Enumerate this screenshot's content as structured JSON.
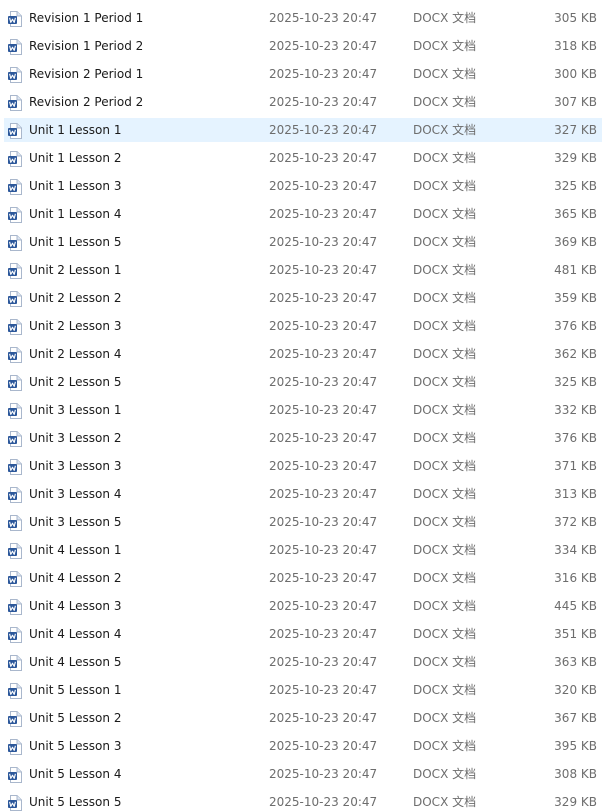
{
  "colors": {
    "selection": "#e5f3ff",
    "icon_blue": "#2b579a",
    "secondary_text": "#6d6d6d"
  },
  "file_icon": "word-document-icon",
  "selected_index": 4,
  "files": [
    {
      "name": "Revision 1 Period 1",
      "date": "2025-10-23 20:47",
      "type": "DOCX 文档",
      "size": "305 KB"
    },
    {
      "name": "Revision 1 Period 2",
      "date": "2025-10-23 20:47",
      "type": "DOCX 文档",
      "size": "318 KB"
    },
    {
      "name": "Revision 2 Period 1",
      "date": "2025-10-23 20:47",
      "type": "DOCX 文档",
      "size": "300 KB"
    },
    {
      "name": "Revision 2 Period 2",
      "date": "2025-10-23 20:47",
      "type": "DOCX 文档",
      "size": "307 KB"
    },
    {
      "name": "Unit 1 Lesson 1",
      "date": "2025-10-23 20:47",
      "type": "DOCX 文档",
      "size": "327 KB"
    },
    {
      "name": "Unit 1 Lesson 2",
      "date": "2025-10-23 20:47",
      "type": "DOCX 文档",
      "size": "329 KB"
    },
    {
      "name": "Unit 1 Lesson 3",
      "date": "2025-10-23 20:47",
      "type": "DOCX 文档",
      "size": "325 KB"
    },
    {
      "name": "Unit 1 Lesson 4",
      "date": "2025-10-23 20:47",
      "type": "DOCX 文档",
      "size": "365 KB"
    },
    {
      "name": "Unit 1 Lesson 5",
      "date": "2025-10-23 20:47",
      "type": "DOCX 文档",
      "size": "369 KB"
    },
    {
      "name": "Unit 2 Lesson 1",
      "date": "2025-10-23 20:47",
      "type": "DOCX 文档",
      "size": "481 KB"
    },
    {
      "name": "Unit 2 Lesson 2",
      "date": "2025-10-23 20:47",
      "type": "DOCX 文档",
      "size": "359 KB"
    },
    {
      "name": "Unit 2 Lesson 3",
      "date": "2025-10-23 20:47",
      "type": "DOCX 文档",
      "size": "376 KB"
    },
    {
      "name": "Unit 2 Lesson 4",
      "date": "2025-10-23 20:47",
      "type": "DOCX 文档",
      "size": "362 KB"
    },
    {
      "name": "Unit 2 Lesson 5",
      "date": "2025-10-23 20:47",
      "type": "DOCX 文档",
      "size": "325 KB"
    },
    {
      "name": "Unit 3 Lesson 1",
      "date": "2025-10-23 20:47",
      "type": "DOCX 文档",
      "size": "332 KB"
    },
    {
      "name": "Unit 3 Lesson 2",
      "date": "2025-10-23 20:47",
      "type": "DOCX 文档",
      "size": "376 KB"
    },
    {
      "name": "Unit 3 Lesson 3",
      "date": "2025-10-23 20:47",
      "type": "DOCX 文档",
      "size": "371 KB"
    },
    {
      "name": "Unit 3 Lesson 4",
      "date": "2025-10-23 20:47",
      "type": "DOCX 文档",
      "size": "313 KB"
    },
    {
      "name": "Unit 3 Lesson 5",
      "date": "2025-10-23 20:47",
      "type": "DOCX 文档",
      "size": "372 KB"
    },
    {
      "name": "Unit 4 Lesson 1",
      "date": "2025-10-23 20:47",
      "type": "DOCX 文档",
      "size": "334 KB"
    },
    {
      "name": "Unit 4 Lesson 2",
      "date": "2025-10-23 20:47",
      "type": "DOCX 文档",
      "size": "316 KB"
    },
    {
      "name": "Unit 4 Lesson 3",
      "date": "2025-10-23 20:47",
      "type": "DOCX 文档",
      "size": "445 KB"
    },
    {
      "name": "Unit 4 Lesson 4",
      "date": "2025-10-23 20:47",
      "type": "DOCX 文档",
      "size": "351 KB"
    },
    {
      "name": "Unit 4 Lesson 5",
      "date": "2025-10-23 20:47",
      "type": "DOCX 文档",
      "size": "363 KB"
    },
    {
      "name": "Unit 5 Lesson 1",
      "date": "2025-10-23 20:47",
      "type": "DOCX 文档",
      "size": "320 KB"
    },
    {
      "name": "Unit 5 Lesson 2",
      "date": "2025-10-23 20:47",
      "type": "DOCX 文档",
      "size": "367 KB"
    },
    {
      "name": "Unit 5 Lesson 3",
      "date": "2025-10-23 20:47",
      "type": "DOCX 文档",
      "size": "395 KB"
    },
    {
      "name": "Unit 5 Lesson 4",
      "date": "2025-10-23 20:47",
      "type": "DOCX 文档",
      "size": "308 KB"
    },
    {
      "name": "Unit 5 Lesson 5",
      "date": "2025-10-23 20:47",
      "type": "DOCX 文档",
      "size": "329 KB"
    }
  ]
}
